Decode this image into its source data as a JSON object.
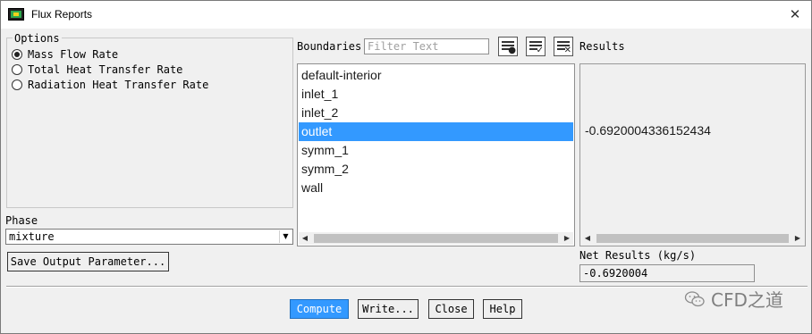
{
  "window": {
    "title": "Flux Reports",
    "close_glyph": "✕"
  },
  "options": {
    "title": "Options",
    "items": [
      {
        "label": "Mass Flow Rate",
        "selected": true
      },
      {
        "label": "Total Heat Transfer Rate",
        "selected": false
      },
      {
        "label": "Radiation Heat Transfer Rate",
        "selected": false
      }
    ]
  },
  "phase": {
    "label": "Phase",
    "value": "mixture"
  },
  "save_output_label": "Save Output Parameter...",
  "boundaries": {
    "label": "Boundaries",
    "filter_placeholder": "Filter Text",
    "tools": [
      "select-all-icon",
      "check-list-icon",
      "clear-selection-icon"
    ],
    "items": [
      "default-interior",
      "inlet_1",
      "inlet_2",
      "outlet",
      "symm_1",
      "symm_2",
      "wall"
    ],
    "selected": "outlet"
  },
  "results": {
    "label": "Results",
    "value": "-0.6920004336152434"
  },
  "net_results": {
    "label": "Net Results (kg/s)",
    "value": "-0.6920004"
  },
  "buttons": {
    "compute": "Compute",
    "write": "Write...",
    "close": "Close",
    "help": "Help"
  },
  "watermark": {
    "text": "CFD之道",
    "icon": "wechat-icon"
  },
  "colors": {
    "selection": "#3399ff",
    "window_bg": "#f0f0f0"
  }
}
